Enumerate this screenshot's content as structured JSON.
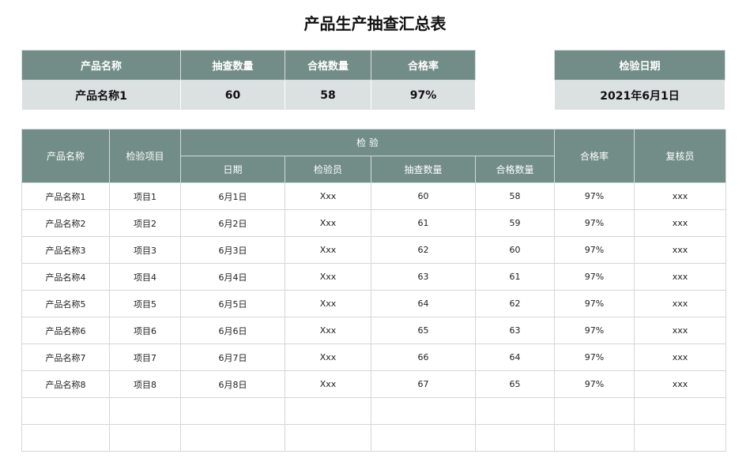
{
  "title": "产品生产抽查汇总表",
  "summary": {
    "headers": [
      "产品名称",
      "抽查数量",
      "合格数量",
      "合格率"
    ],
    "values": [
      "产品名称1",
      "60",
      "58",
      "97%"
    ]
  },
  "inspection_date": {
    "header": "检验日期",
    "value": "2021年6月1日"
  },
  "detail": {
    "headers": {
      "product": "产品名称",
      "item": "检验项目",
      "inspection_group": "检 验",
      "date": "日期",
      "inspector": "检验员",
      "sample_qty": "抽查数量",
      "pass_qty": "合格数量",
      "pass_rate": "合格率",
      "reviewer": "复核员"
    },
    "rows": [
      [
        "产品名称1",
        "项目1",
        "6月1日",
        "Xxx",
        "60",
        "58",
        "97%",
        "xxx"
      ],
      [
        "产品名称2",
        "项目2",
        "6月2日",
        "Xxx",
        "61",
        "59",
        "97%",
        "xxx"
      ],
      [
        "产品名称3",
        "项目3",
        "6月3日",
        "Xxx",
        "62",
        "60",
        "97%",
        "xxx"
      ],
      [
        "产品名称4",
        "项目4",
        "6月4日",
        "Xxx",
        "63",
        "61",
        "97%",
        "xxx"
      ],
      [
        "产品名称5",
        "项目5",
        "6月5日",
        "Xxx",
        "64",
        "62",
        "97%",
        "xxx"
      ],
      [
        "产品名称6",
        "项目6",
        "6月6日",
        "Xxx",
        "65",
        "63",
        "97%",
        "xxx"
      ],
      [
        "产品名称7",
        "项目7",
        "6月7日",
        "Xxx",
        "66",
        "64",
        "97%",
        "xxx"
      ],
      [
        "产品名称8",
        "项目8",
        "6月8日",
        "Xxx",
        "67",
        "65",
        "97%",
        "xxx"
      ],
      [
        "",
        "",
        "",
        "",
        "",
        "",
        "",
        ""
      ],
      [
        "",
        "",
        "",
        "",
        "",
        "",
        "",
        ""
      ]
    ]
  },
  "colors": {
    "header_bg": "#728d87",
    "value_bg": "#dbe1e0"
  }
}
